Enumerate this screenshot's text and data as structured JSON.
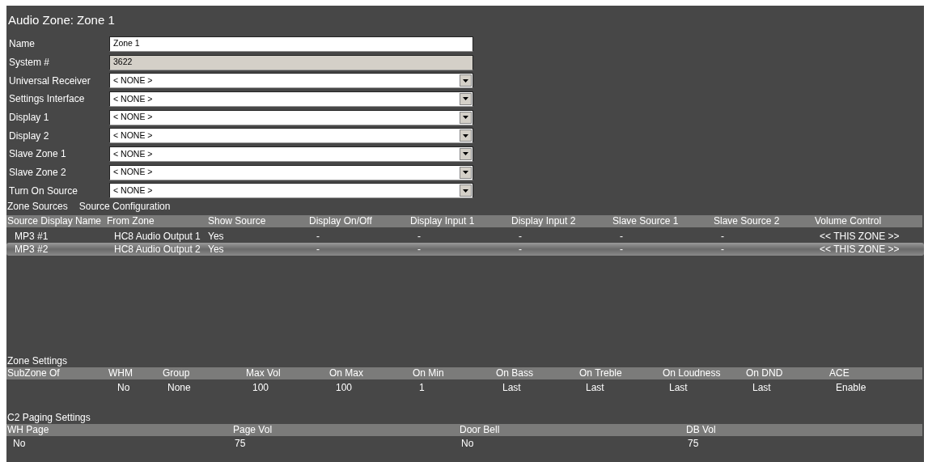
{
  "title": "Audio Zone: Zone 1",
  "fields": [
    {
      "label": "Name",
      "kind": "text",
      "value": "Zone 1"
    },
    {
      "label": "System #",
      "kind": "readonly",
      "value": "3622"
    },
    {
      "label": "Universal Receiver",
      "kind": "select",
      "value": "< NONE >"
    },
    {
      "label": "Settings Interface",
      "kind": "select",
      "value": "< NONE >"
    },
    {
      "label": "Display 1",
      "kind": "select",
      "value": "< NONE >"
    },
    {
      "label": "Display 2",
      "kind": "select",
      "value": "< NONE >"
    },
    {
      "label": "Slave Zone 1",
      "kind": "select",
      "value": "< NONE >"
    },
    {
      "label": "Slave Zone 2",
      "kind": "select",
      "value": "< NONE >"
    },
    {
      "label": "Turn On Source",
      "kind": "select",
      "value": "< NONE >"
    }
  ],
  "zone_sources": {
    "title": "Zone Sources",
    "subtitle": "Source Configuration",
    "columns": [
      "Source Display Name",
      "From Zone",
      "Show Source",
      "Display On/Off",
      "Display Input 1",
      "Display Input 2",
      "Slave Source 1",
      "Slave Source 2",
      "Volume Control"
    ],
    "rows": [
      {
        "selected": false,
        "cells": [
          "MP3 #1",
          "HC8 Audio Output 1",
          "Yes",
          "-",
          "-",
          "-",
          "-",
          "-",
          "<< THIS ZONE >>"
        ]
      },
      {
        "selected": true,
        "cells": [
          "MP3 #2",
          "HC8 Audio Output 2",
          "Yes",
          "-",
          "-",
          "-",
          "-",
          "-",
          "<< THIS ZONE >>"
        ]
      }
    ]
  },
  "zone_settings": {
    "title": "Zone Settings",
    "columns": [
      "SubZone Of",
      "WHM",
      "Group",
      "Max Vol",
      "On Max",
      "On Min",
      "On Bass",
      "On Treble",
      "On Loudness",
      "On DND",
      "ACE"
    ],
    "values": [
      "No",
      "None",
      "100",
      "100",
      "1",
      "Last",
      "Last",
      "Last",
      "Last",
      "Enable"
    ]
  },
  "paging": {
    "title": "C2 Paging Settings",
    "columns": [
      "WH Page",
      "Page Vol",
      "Door Bell",
      "DB Vol"
    ],
    "values": [
      "No",
      "75",
      "No",
      "75"
    ]
  }
}
